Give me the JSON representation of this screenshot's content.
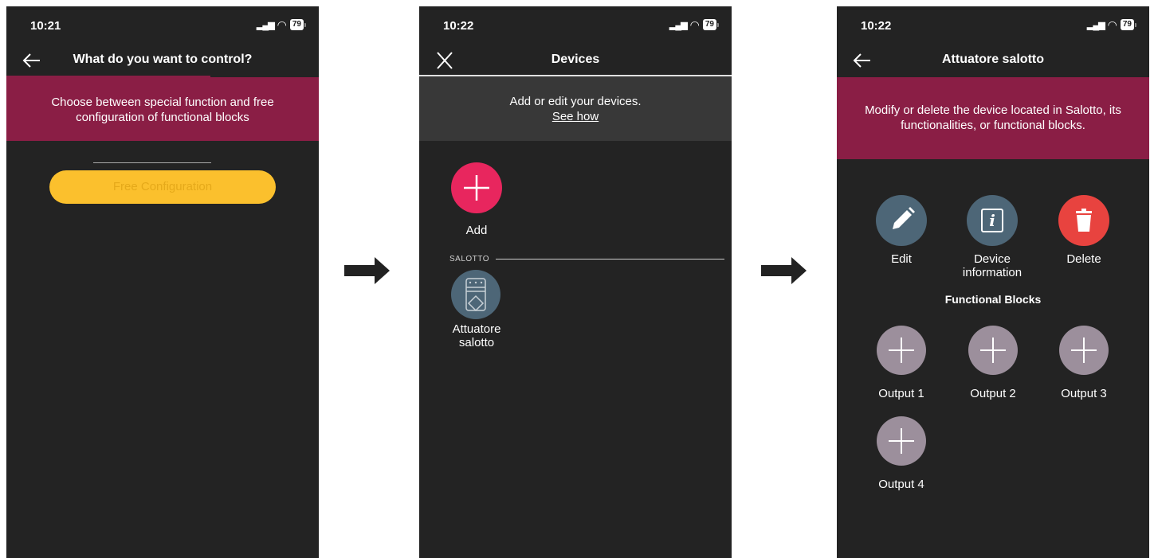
{
  "screen1": {
    "status": {
      "time": "10:21",
      "battery": "79"
    },
    "nav": {
      "title": "What do you want to control?",
      "back_icon": "arrow-left-icon"
    },
    "banner": {
      "text_line1": "Choose between special function and free",
      "text_line2": "configuration of functional blocks"
    },
    "free_config_label": "Free Configuration",
    "colors": {
      "banner": "#8a1e45",
      "button": "#fbc02d"
    }
  },
  "screen2": {
    "status": {
      "time": "10:22",
      "battery": "79"
    },
    "nav": {
      "title": "Devices",
      "close_icon": "close-icon"
    },
    "banner": {
      "text": "Add or edit your devices.",
      "link": "See how"
    },
    "add_label": "Add",
    "section": "SALOTTO",
    "device": {
      "label_line1": "Attuatore",
      "label_line2": "salotto",
      "icon": "actuator-icon"
    },
    "colors": {
      "add": "#e8265e",
      "device": "#4d6677"
    }
  },
  "screen3": {
    "status": {
      "time": "10:22",
      "battery": "79"
    },
    "nav": {
      "title": "Attuatore salotto",
      "back_icon": "arrow-left-icon"
    },
    "banner": {
      "text_line1": "Modify or delete the device located in Salotto, its",
      "text_line2": "functionalities, or functional blocks."
    },
    "actions": {
      "edit": "Edit",
      "info_line1": "Device",
      "info_line2": "information",
      "delete": "Delete"
    },
    "functional_blocks_title": "Functional Blocks",
    "outputs": [
      "Output 1",
      "Output 2",
      "Output 3",
      "Output 4"
    ],
    "colors": {
      "action": "#4d6677",
      "delete": "#e8433f",
      "output": "#9c8f9c"
    }
  },
  "flow_arrows": [
    "arrow-right-icon",
    "arrow-right-icon"
  ]
}
